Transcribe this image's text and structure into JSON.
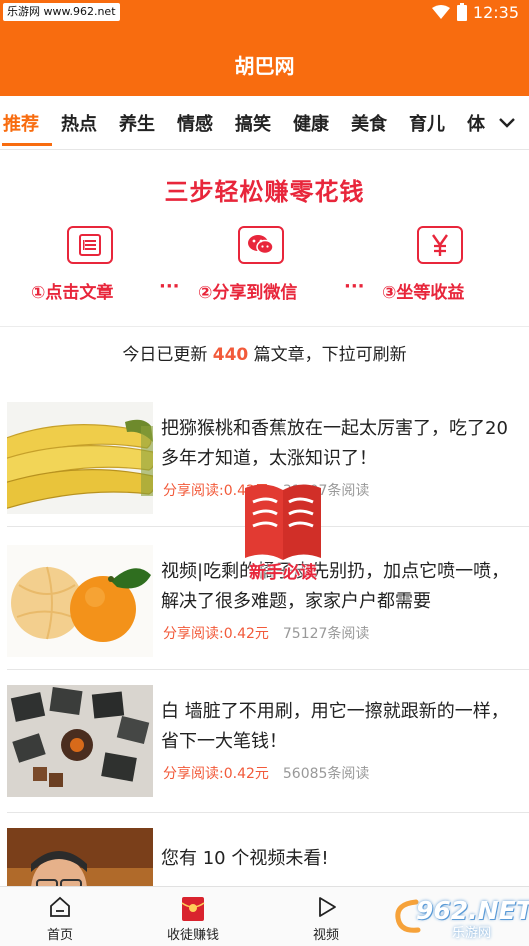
{
  "status_bar": {
    "watermark": "乐游网 www.962.net",
    "time": "12:35"
  },
  "header": {
    "title": "胡巴网"
  },
  "tabs": [
    {
      "label": "推荐",
      "active": true
    },
    {
      "label": "热点"
    },
    {
      "label": "养生"
    },
    {
      "label": "情感"
    },
    {
      "label": "搞笑"
    },
    {
      "label": "健康"
    },
    {
      "label": "美食"
    },
    {
      "label": "育儿"
    },
    {
      "label": "体"
    }
  ],
  "tabs_more_icon": "chevron-down-icon",
  "banner": {
    "title": "三步轻松赚零花钱",
    "steps": [
      {
        "icon": "article-icon",
        "label": "①点击文章"
      },
      {
        "icon": "wechat-icon",
        "label": "②分享到微信"
      },
      {
        "icon": "yen-icon",
        "label": "③坐等收益"
      }
    ],
    "separator": "···"
  },
  "update": {
    "prefix": "今日已更新 ",
    "count": "440",
    "suffix": " 篇文章，下拉可刷新"
  },
  "articles": [
    {
      "title": "把猕猴桃和香蕉放在一起太厉害了，吃了20多年才知道，太涨知识了！",
      "earn": "分享阅读:0.42元",
      "reads": "31307条阅读",
      "thumb": "bananas"
    },
    {
      "title": "视频|吃剩的橘子皮先别扔，加点它喷一喷，解决了很多难题，家家户户都需要",
      "earn": "分享阅读:0.42元",
      "reads": "75127条阅读",
      "thumb": "oranges"
    },
    {
      "title": "白 墙脏了不用刷，用它一擦就跟新的一样，省下一大笔钱！",
      "earn": "分享阅读:0.42元",
      "reads": "56085条阅读",
      "thumb": "photos"
    },
    {
      "title": "您有 10 个视频未看!",
      "thumb": "man"
    }
  ],
  "float_badge": {
    "label": "新手必读"
  },
  "bottom_nav": [
    {
      "label": "首页",
      "icon": "home-icon"
    },
    {
      "label": "收徒赚钱",
      "icon": "red-envelope-icon"
    },
    {
      "label": "视频",
      "icon": "play-icon"
    }
  ],
  "corner_logo": {
    "text": "962.NET",
    "sub": "乐游网"
  },
  "colors": {
    "brand": "#f86c0f",
    "accent_red": "#e8263b",
    "earn_red": "#f25a3a"
  }
}
